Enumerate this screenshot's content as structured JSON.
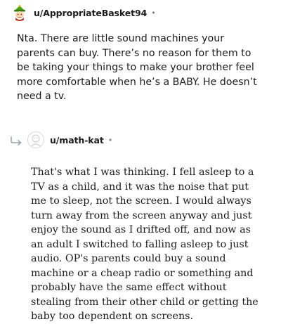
{
  "comments": [
    {
      "username": "u/AppropriateBasket94",
      "separator": "•",
      "avatar_icon": "snoo-avatar-icon",
      "text": "Nta. There are little sound machines your parents can buy. There’s no reason for them to be taking your things to make your brother feel more comfortable when he’s a BABY. He doesn’t need a tv."
    },
    {
      "username": "u/math-kat",
      "separator": "•",
      "avatar_icon": "default-avatar-icon",
      "reply_icon": "reply-arrow-icon",
      "text": "That's what I was thinking. I fell asleep to a TV as a child, and it was the noise that put me to sleep, not the screen. I would always turn away from the screen anyway and just enjoy the sound as I drifted off, and now as an adult I switched to falling asleep to just audio. OP's parents could buy a sound machine or a cheap radio or something and probably have the same effect without stealing from their other child or getting the baby too dependent on screens."
    }
  ],
  "colors": {
    "text": "#1c1c1c",
    "meta": "#7c7c7c",
    "reply_arrow": "#9aa0a6",
    "avatar_border": "#d8dadc"
  }
}
